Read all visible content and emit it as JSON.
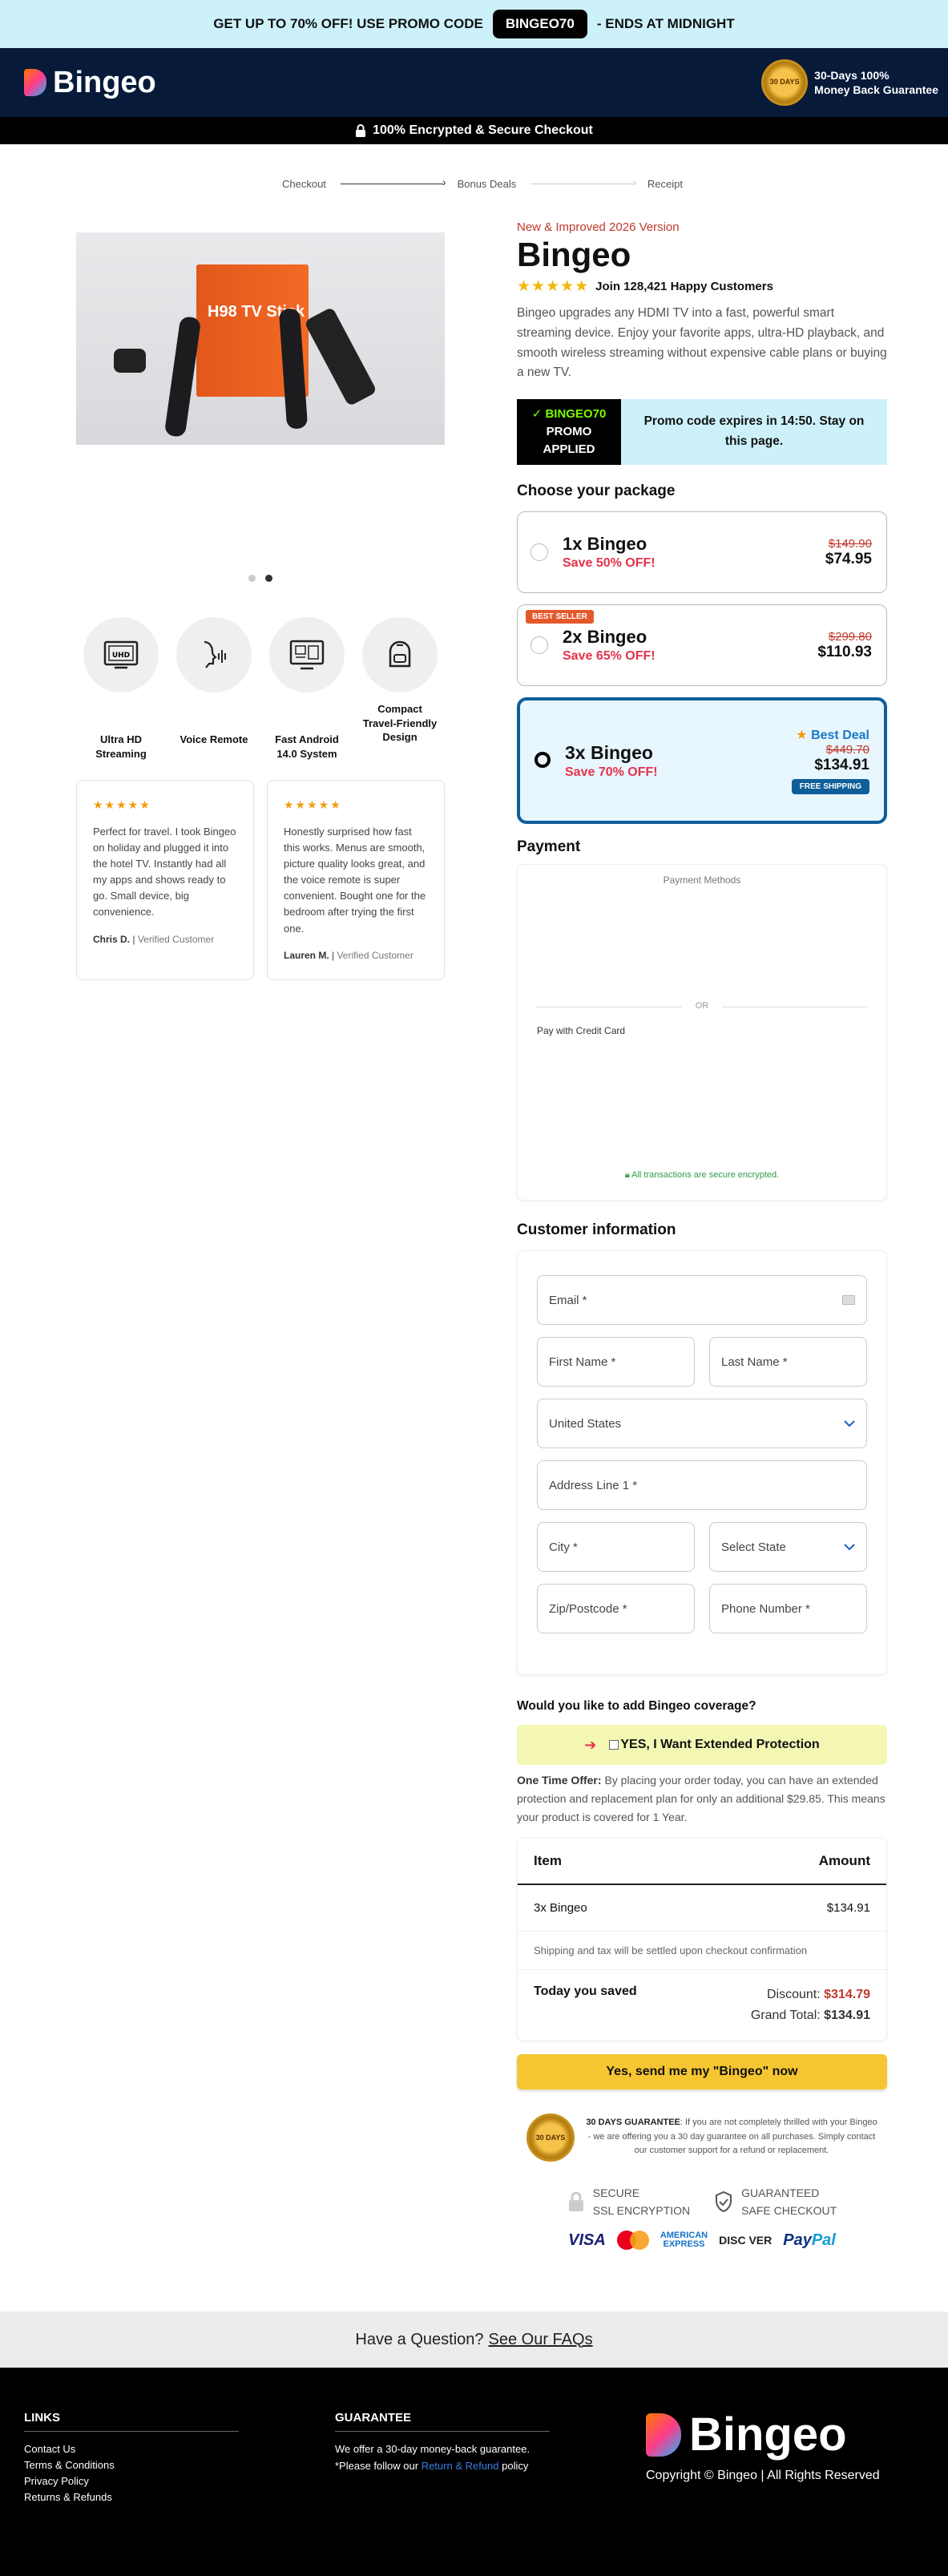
{
  "topbar": {
    "text_before": "GET UP TO 70% OFF! USE PROMO CODE",
    "code": "BINGEO70",
    "text_after": "- ENDS AT MIDNIGHT"
  },
  "header": {
    "brand": "Bingeo",
    "guarantee_line1": "30-Days 100%",
    "guarantee_line2": "Money Back Guarantee",
    "seal_text": "30 DAYS"
  },
  "securebar": {
    "text": "100% Encrypted & Secure Checkout"
  },
  "steps": [
    "Checkout",
    "Bonus Deals",
    "Receipt"
  ],
  "gallery": {
    "box_label": "H98 TV Stick"
  },
  "features": [
    {
      "icon": "hd-tv-icon",
      "label": "Ultra HD Streaming"
    },
    {
      "icon": "voice-icon",
      "label": "Voice Remote"
    },
    {
      "icon": "android-tv-icon",
      "label": "Fast Android 14.0 System"
    },
    {
      "icon": "travel-bag-icon",
      "label": "Compact Travel-Friendly Design"
    }
  ],
  "reviews": [
    {
      "stars": "★★★★★",
      "text": "Perfect for travel. I took Bingeo on holiday and plugged it into the hotel TV. Instantly had all my apps and shows ready to go. Small device, big convenience.",
      "name": "Chris D.",
      "badge": "Verified Customer"
    },
    {
      "stars": "★★★★★",
      "text": "Honestly surprised how fast this works. Menus are smooth, picture quality looks great, and the voice remote is super convenient. Bought one for the bedroom after trying the first one.",
      "name": "Lauren M.",
      "badge": "Verified Customer"
    }
  ],
  "product": {
    "eyebrow": "New & Improved 2026 Version",
    "title": "Bingeo",
    "rating_stars": "★★★★★",
    "rating_text": "Join 128,421 Happy Customers",
    "description": "Bingeo upgrades any HDMI TV into a fast, powerful smart streaming device. Enjoy your favorite apps, ultra-HD playback, and smooth wireless streaming without expensive cable plans or buying a new TV."
  },
  "promo": {
    "code_line": "✓ BINGEO70",
    "line2": "PROMO",
    "line3": "APPLIED",
    "expires": "Promo code expires in 14:50. Stay on this page."
  },
  "packages_title": "Choose your package",
  "packages": [
    {
      "name": "1x Bingeo",
      "save": "Save 50% OFF!",
      "old": "$149.90",
      "new": "$74.95"
    },
    {
      "name": "2x Bingeo",
      "save": "Save 65% OFF!",
      "old": "$299.80",
      "new": "$110.93",
      "tag": "BEST SELLER"
    },
    {
      "name": "3x Bingeo",
      "save": "Save 70% OFF!",
      "old": "$449.70",
      "new": "$134.91",
      "deal": "Best Deal",
      "ship": "FREE SHIPPING"
    }
  ],
  "payment": {
    "title": "Payment",
    "methods": "Payment Methods",
    "or": "OR",
    "cc": "Pay with Credit Card",
    "secure": "All transactions are secure encrypted."
  },
  "customer": {
    "title": "Customer information",
    "email": "Email *",
    "first": "First Name *",
    "last": "Last Name *",
    "country": "United States",
    "address": "Address Line 1 *",
    "city": "City *",
    "state": "Select State",
    "zip": "Zip/Postcode *",
    "phone": "Phone Number *"
  },
  "coverage": {
    "question": "Would you like to add Bingeo coverage?",
    "label": "YES, I Want Extended Protection",
    "offer_label": "One Time Offer:",
    "offer_text": "By placing your order today, you can have an extended protection and replacement plan for only an additional $29.85. This means your product is covered for 1 Year."
  },
  "summary": {
    "col_item": "Item",
    "col_amount": "Amount",
    "item": "3x Bingeo",
    "amount": "$134.91",
    "note": "Shipping and tax will be settled upon checkout confirmation",
    "saved_label": "Today you saved",
    "discount_label": "Discount:",
    "discount": "$314.79",
    "total_label": "Grand Total:",
    "total": "$134.91"
  },
  "cta": "Yes, send me my \"Bingeo\" now",
  "guarantee": {
    "title": "30 DAYS GUARANTEE",
    "text": ": If you are not completely thrilled with your Bingeo - we are offering you a 30 day guarantee on all purchases. Simply contact our customer support for a refund or replacement."
  },
  "trust": {
    "ssl1": "SECURE",
    "ssl2": "SSL ENCRYPTION",
    "safe1": "GUARANTEED",
    "safe2": "SAFE CHECKOUT"
  },
  "cards": {
    "visa": "VISA",
    "amex1": "AMERICAN",
    "amex2": "EXPRESS",
    "discover": "DISC VER",
    "paypal1": "Pay",
    "paypal2": "Pal"
  },
  "faq": {
    "text": "Have a Question?",
    "link": "See Our FAQs"
  },
  "footer": {
    "links_title": "LINKS",
    "links": [
      "Contact Us",
      "Terms & Conditions",
      "Privacy Policy",
      "Returns & Refunds"
    ],
    "guarantee_title": "GUARANTEE",
    "guarantee_line1": "We offer a 30-day money-back guarantee.",
    "guarantee_line2a": "*Please follow our",
    "guarantee_link": "Return & Refund",
    "guarantee_line2b": "policy",
    "brand": "Bingeo",
    "copyright": "Copyright © Bingeo | All Rights Reserved"
  }
}
